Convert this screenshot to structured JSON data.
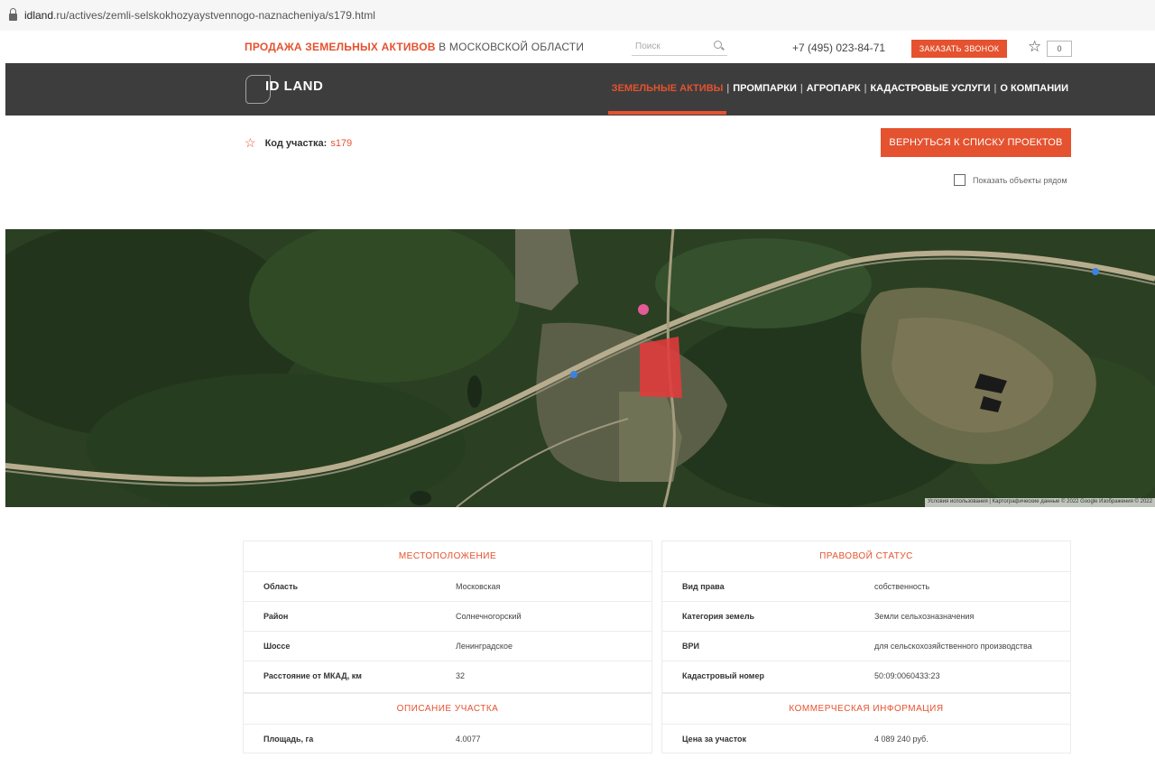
{
  "browser": {
    "url_host": "idland",
    "url_rest": ".ru/actives/zemli-selskokhozyaystvennogo-naznacheniya/s179.html"
  },
  "topbar": {
    "promo_highlight": "ПРОДАЖА ЗЕМЕЛЬНЫХ АКТИВОВ",
    "promo_rest": " В МОСКОВСКОЙ ОБЛАСТИ",
    "search_placeholder": "Поиск",
    "phone": "+7 (495) 023-84-71",
    "call_button": "ЗАКАЗАТЬ ЗВОНОК",
    "favorites_count": "0"
  },
  "nav": {
    "logo": "ID LAND",
    "items": [
      "ЗЕМЕЛЬНЫЕ АКТИВЫ",
      "ПРОМПАРКИ",
      "АГРОПАРК",
      "КАДАСТРОВЫЕ УСЛУГИ",
      "О КОМПАНИИ"
    ],
    "separator": "|"
  },
  "project": {
    "code_label": "Код участка:",
    "code_value": "s179",
    "back_button": "ВЕРНУТЬСЯ К СПИСКУ ПРОЕКТОВ",
    "nearby_label": "Показать объекты рядом"
  },
  "map": {
    "attribution": "Условия использования | Картографические данные © 2022 Google Изображения © 2022"
  },
  "location": {
    "title": "МЕСТОПОЛОЖЕНИЕ",
    "rows": [
      {
        "k": "Область",
        "v": "Московская"
      },
      {
        "k": "Район",
        "v": "Солнечногорский"
      },
      {
        "k": "Шоссе",
        "v": "Ленинградское"
      },
      {
        "k": "Расстояние от МКАД, км",
        "v": "32"
      }
    ]
  },
  "legal": {
    "title": "ПРАВОВОЙ СТАТУС",
    "rows": [
      {
        "k": "Вид права",
        "v": "собственность"
      },
      {
        "k": "Категория земель",
        "v": "Земли сельхозназначения"
      },
      {
        "k": "ВРИ",
        "v": "для сельскохозяйственного производства"
      },
      {
        "k": "Кадастровый номер",
        "v": "50:09:0060433:23"
      }
    ]
  },
  "description": {
    "title": "ОПИСАНИЕ УЧАСТКА",
    "rows": [
      {
        "k": "Площадь, га",
        "v": "4.0077"
      }
    ]
  },
  "commercial": {
    "title": "КОММЕРЧЕСКАЯ ИНФОРМАЦИЯ",
    "rows": [
      {
        "k": "Цена за участок",
        "v": "4 089 240 руб."
      }
    ]
  },
  "colors": {
    "accent": "#e5522f",
    "navbar": "#3d3d3d",
    "plot": "#e23b3b"
  }
}
